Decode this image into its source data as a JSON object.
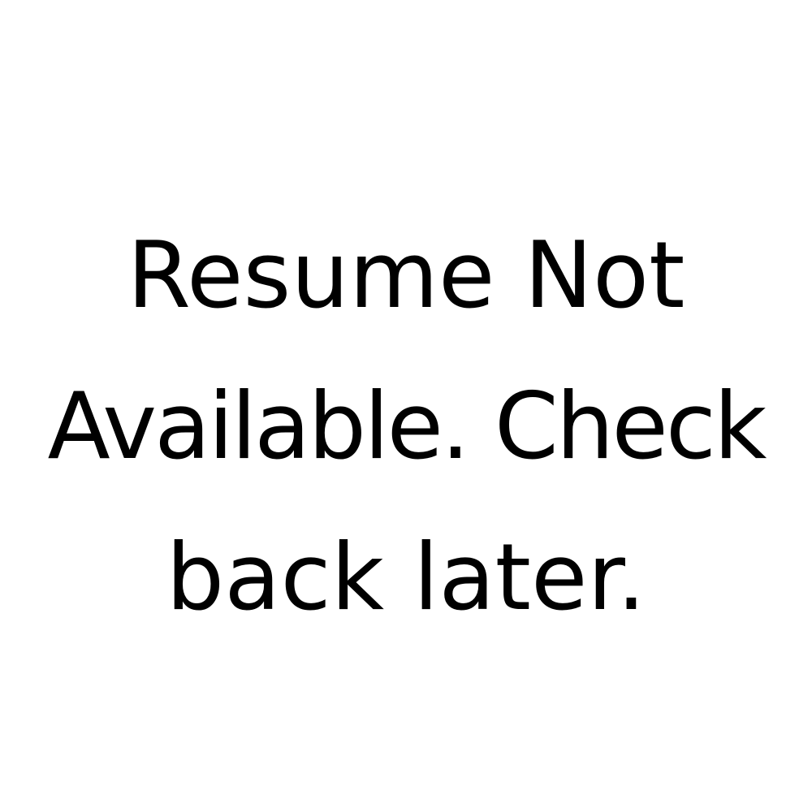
{
  "message": {
    "lines": [
      "Resume Not",
      "Available. Check",
      "back later."
    ]
  },
  "colors": {
    "background": "#ffffff",
    "text": "#000000"
  }
}
